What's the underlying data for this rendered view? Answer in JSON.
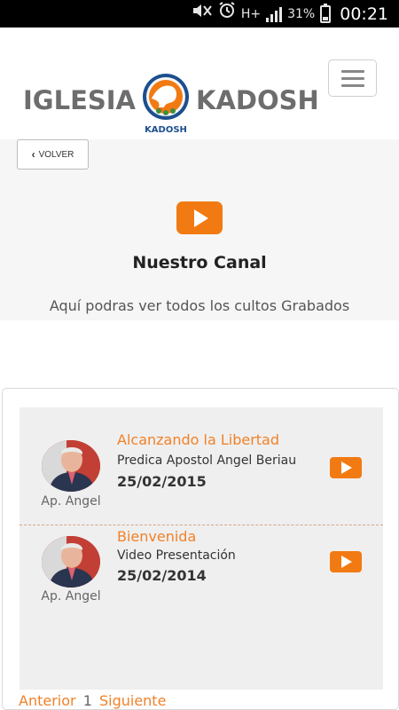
{
  "status_bar": {
    "icons": [
      "mute-icon",
      "alarm-icon",
      "hplus-data-icon",
      "signal-icon",
      "battery-icon"
    ],
    "network": "H+",
    "battery_percent": "31%",
    "battery_level": 0.31,
    "time": "00:21"
  },
  "header": {
    "brand_left": "IGLESIA",
    "brand_right": "KADOSH",
    "logo_text": "KADOSH"
  },
  "hero": {
    "back_label": "VOLVER",
    "title": "Nuestro Canal",
    "subtitle": "Aquí podras ver todos los cultos Grabados"
  },
  "videos": [
    {
      "title": "Alcanzando la Libertad",
      "description": "Predica Apostol Angel Beriau",
      "date": "25/02/2015",
      "author": "Ap. Angel"
    },
    {
      "title": "Bienvenida",
      "description": "Video Presentación",
      "date": "25/02/2014",
      "author": "Ap. Angel"
    }
  ],
  "pagination": {
    "prev": "Anterior",
    "current": "1",
    "next": "Siguiente"
  },
  "colors": {
    "accent": "#f27a12",
    "text_link": "#f0822a",
    "brand_gray": "#6d6d6d"
  }
}
